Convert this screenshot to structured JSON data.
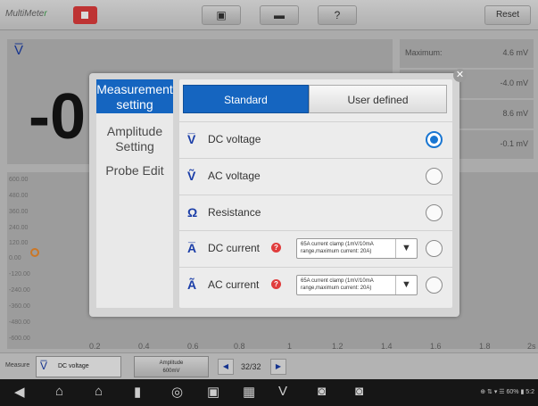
{
  "app": {
    "title": "MultiMete",
    "title_suffix": "r"
  },
  "toolbar": {
    "reset_label": "Reset"
  },
  "reading": {
    "symbol": "V̅",
    "value": "-0"
  },
  "stats": [
    {
      "label": "Maximum:",
      "value": "4.6 mV"
    },
    {
      "label": "",
      "value": "-4.0 mV"
    },
    {
      "label": "",
      "value": "8.6 mV"
    },
    {
      "label": "",
      "value": "-0.1 mV"
    }
  ],
  "graph": {
    "y_ticks": [
      "600.00",
      "480.00",
      "360.00",
      "240.00",
      "120.00",
      "0.00",
      "-120.00",
      "-240.00",
      "-360.00",
      "-480.00",
      "-600.00"
    ],
    "x_ticks": [
      "0.2",
      "0.4",
      "0.6",
      "0.8",
      "1",
      "1.2",
      "1.4",
      "1.6",
      "1.8",
      "2s"
    ]
  },
  "measure_bar": {
    "label": "Measure",
    "selected": "DC voltage",
    "amplitude_label": "Amplitude",
    "amplitude_value": "600mV",
    "page": "32/32"
  },
  "dialog": {
    "side_items": [
      {
        "label": "Measurement setting"
      },
      {
        "label": "Amplitude Setting"
      },
      {
        "label": "Probe Edit"
      }
    ],
    "tabs": [
      {
        "label": "Standard"
      },
      {
        "label": "User defined"
      }
    ],
    "rows": [
      {
        "icon": "V̅",
        "label": "DC voltage",
        "selected": true
      },
      {
        "icon": "Ṽ",
        "label": "AC voltage",
        "selected": false
      },
      {
        "icon": "Ω",
        "label": "Resistance",
        "selected": false
      },
      {
        "icon": "A̅",
        "label": "DC current",
        "clamp": "65A current clamp (1mV/10mA range,maximum current: 20A)",
        "selected": false
      },
      {
        "icon": "Ã",
        "label": "AC current",
        "clamp": "65A current clamp (1mV/10mA range,maximum current: 20A)",
        "selected": false
      }
    ]
  },
  "sysbar": {
    "status": "⊕ ⇅ ▾ ☰ 60% ▮ 5:2"
  },
  "colors": {
    "accent": "#1565c0",
    "stop": "#e03c3c",
    "marker": "#f08c2c"
  }
}
